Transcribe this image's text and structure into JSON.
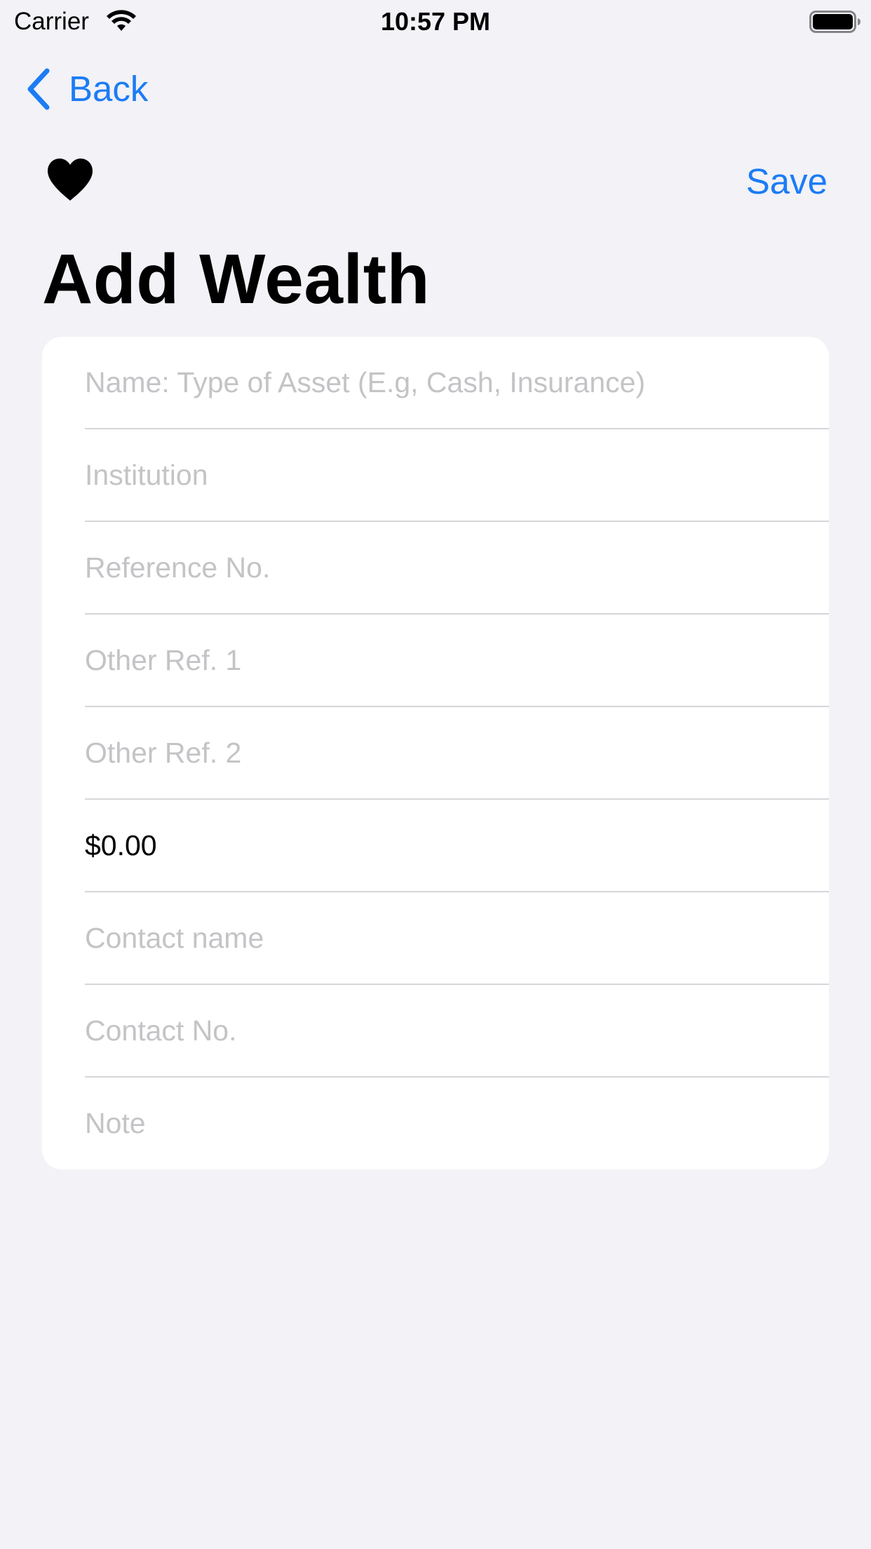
{
  "status_bar": {
    "carrier": "Carrier",
    "time": "10:57 PM"
  },
  "nav": {
    "back_label": "Back",
    "save_label": "Save"
  },
  "page": {
    "title": "Add Wealth"
  },
  "icons": {
    "back": "chevron-left-icon",
    "favorite": "heart-icon",
    "wifi": "wifi-icon",
    "battery": "battery-icon"
  },
  "colors": {
    "accent": "#1c7cf4",
    "background": "#f2f2f7",
    "card": "#ffffff",
    "placeholder": "#c4c4c7"
  },
  "form": {
    "fields": [
      {
        "placeholder": "Name: Type of Asset (E.g, Cash, Insurance)",
        "value": ""
      },
      {
        "placeholder": "Institution",
        "value": ""
      },
      {
        "placeholder": "Reference No.",
        "value": ""
      },
      {
        "placeholder": "Other Ref. 1",
        "value": ""
      },
      {
        "placeholder": "Other Ref. 2",
        "value": ""
      },
      {
        "placeholder": "",
        "value": "$0.00"
      },
      {
        "placeholder": "Contact name",
        "value": ""
      },
      {
        "placeholder": "Contact No.",
        "value": ""
      },
      {
        "placeholder": "Note",
        "value": ""
      }
    ]
  }
}
